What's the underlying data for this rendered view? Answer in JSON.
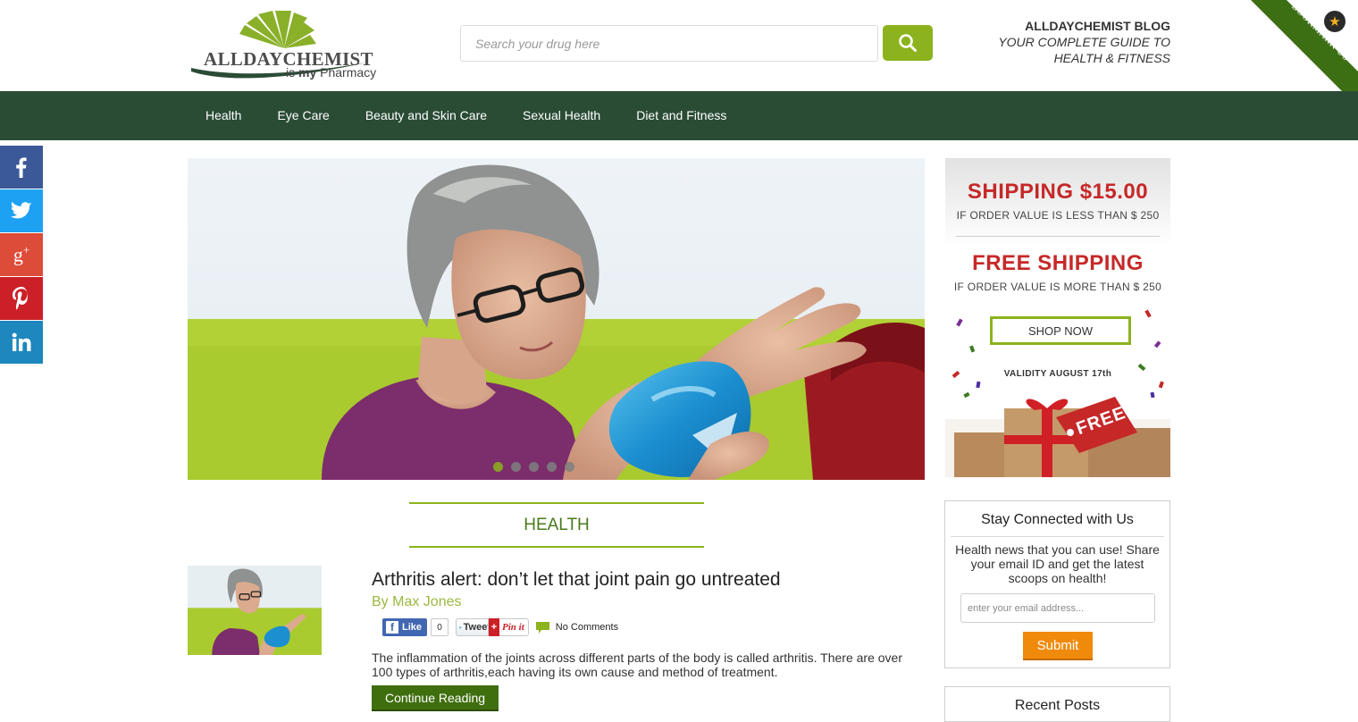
{
  "header": {
    "logo": {
      "wordmark": "ALLDAYCHEMIST",
      "tagline_pre": "is",
      "tagline_bold": "my",
      "tagline_post": "Pharmacy"
    },
    "search": {
      "placeholder": "Search your drug here"
    },
    "blog": {
      "title": "ALLDAYCHEMIST BLOG",
      "subtitle_line1": "YOUR COMPLETE GUIDE TO",
      "subtitle_line2": "HEALTH & FITNESS"
    },
    "bookmark": {
      "label": "BOOKMARK US"
    }
  },
  "nav": {
    "items": [
      {
        "label": "Health"
      },
      {
        "label": "Eye Care"
      },
      {
        "label": "Beauty and Skin Care"
      },
      {
        "label": "Sexual Health"
      },
      {
        "label": "Diet and Fitness"
      }
    ]
  },
  "social": {
    "items": [
      {
        "icon": "facebook-icon",
        "color": "#3b5998"
      },
      {
        "icon": "twitter-icon",
        "color": "#1da1f2"
      },
      {
        "icon": "google-plus-icon",
        "color": "#dd4b39"
      },
      {
        "icon": "pinterest-icon",
        "color": "#cb2027"
      },
      {
        "icon": "linkedin-icon",
        "color": "#1d87be"
      }
    ]
  },
  "slider": {
    "slide_count": 5,
    "active_slide": 1
  },
  "sidebar_ad": {
    "shipping_headline": "SHIPPING $15.00",
    "shipping_condition": "IF ORDER VALUE IS LESS THAN $ 250",
    "free_headline": "FREE SHIPPING",
    "free_condition": "IF ORDER VALUE IS MORE THAN $ 250",
    "shop_label": "SHOP NOW",
    "validity": "VALIDITY AUGUST 17th",
    "tag_text": "FREE"
  },
  "category": {
    "label": "HEALTH"
  },
  "post": {
    "title": "Arthritis alert: don’t let that joint pain go untreated",
    "author": "By Max Jones",
    "like_label": "Like",
    "like_count": "0",
    "tweet_label": "Tweet",
    "pin_label": "Pin it",
    "comments": "No Comments",
    "excerpt": "The inflammation of the joints across different parts of the body is called arthritis. There are over 100 types of arthritis,each having its own cause and method of treatment.",
    "continue_label": "Continue Reading"
  },
  "newsletter": {
    "title": "Stay Connected with Us",
    "text": "Health news that you can use! Share your email ID and get the latest scoops on health!",
    "email_placeholder": "enter your email address...",
    "submit_label": "Submit"
  },
  "recent_posts": {
    "title": "Recent Posts"
  },
  "colors": {
    "nav_bg": "#2a4c35",
    "accent_green": "#8cb31d",
    "button_dark_green": "#3f6e0f",
    "submit_orange": "#f08a0b",
    "ad_red": "#c62828"
  }
}
